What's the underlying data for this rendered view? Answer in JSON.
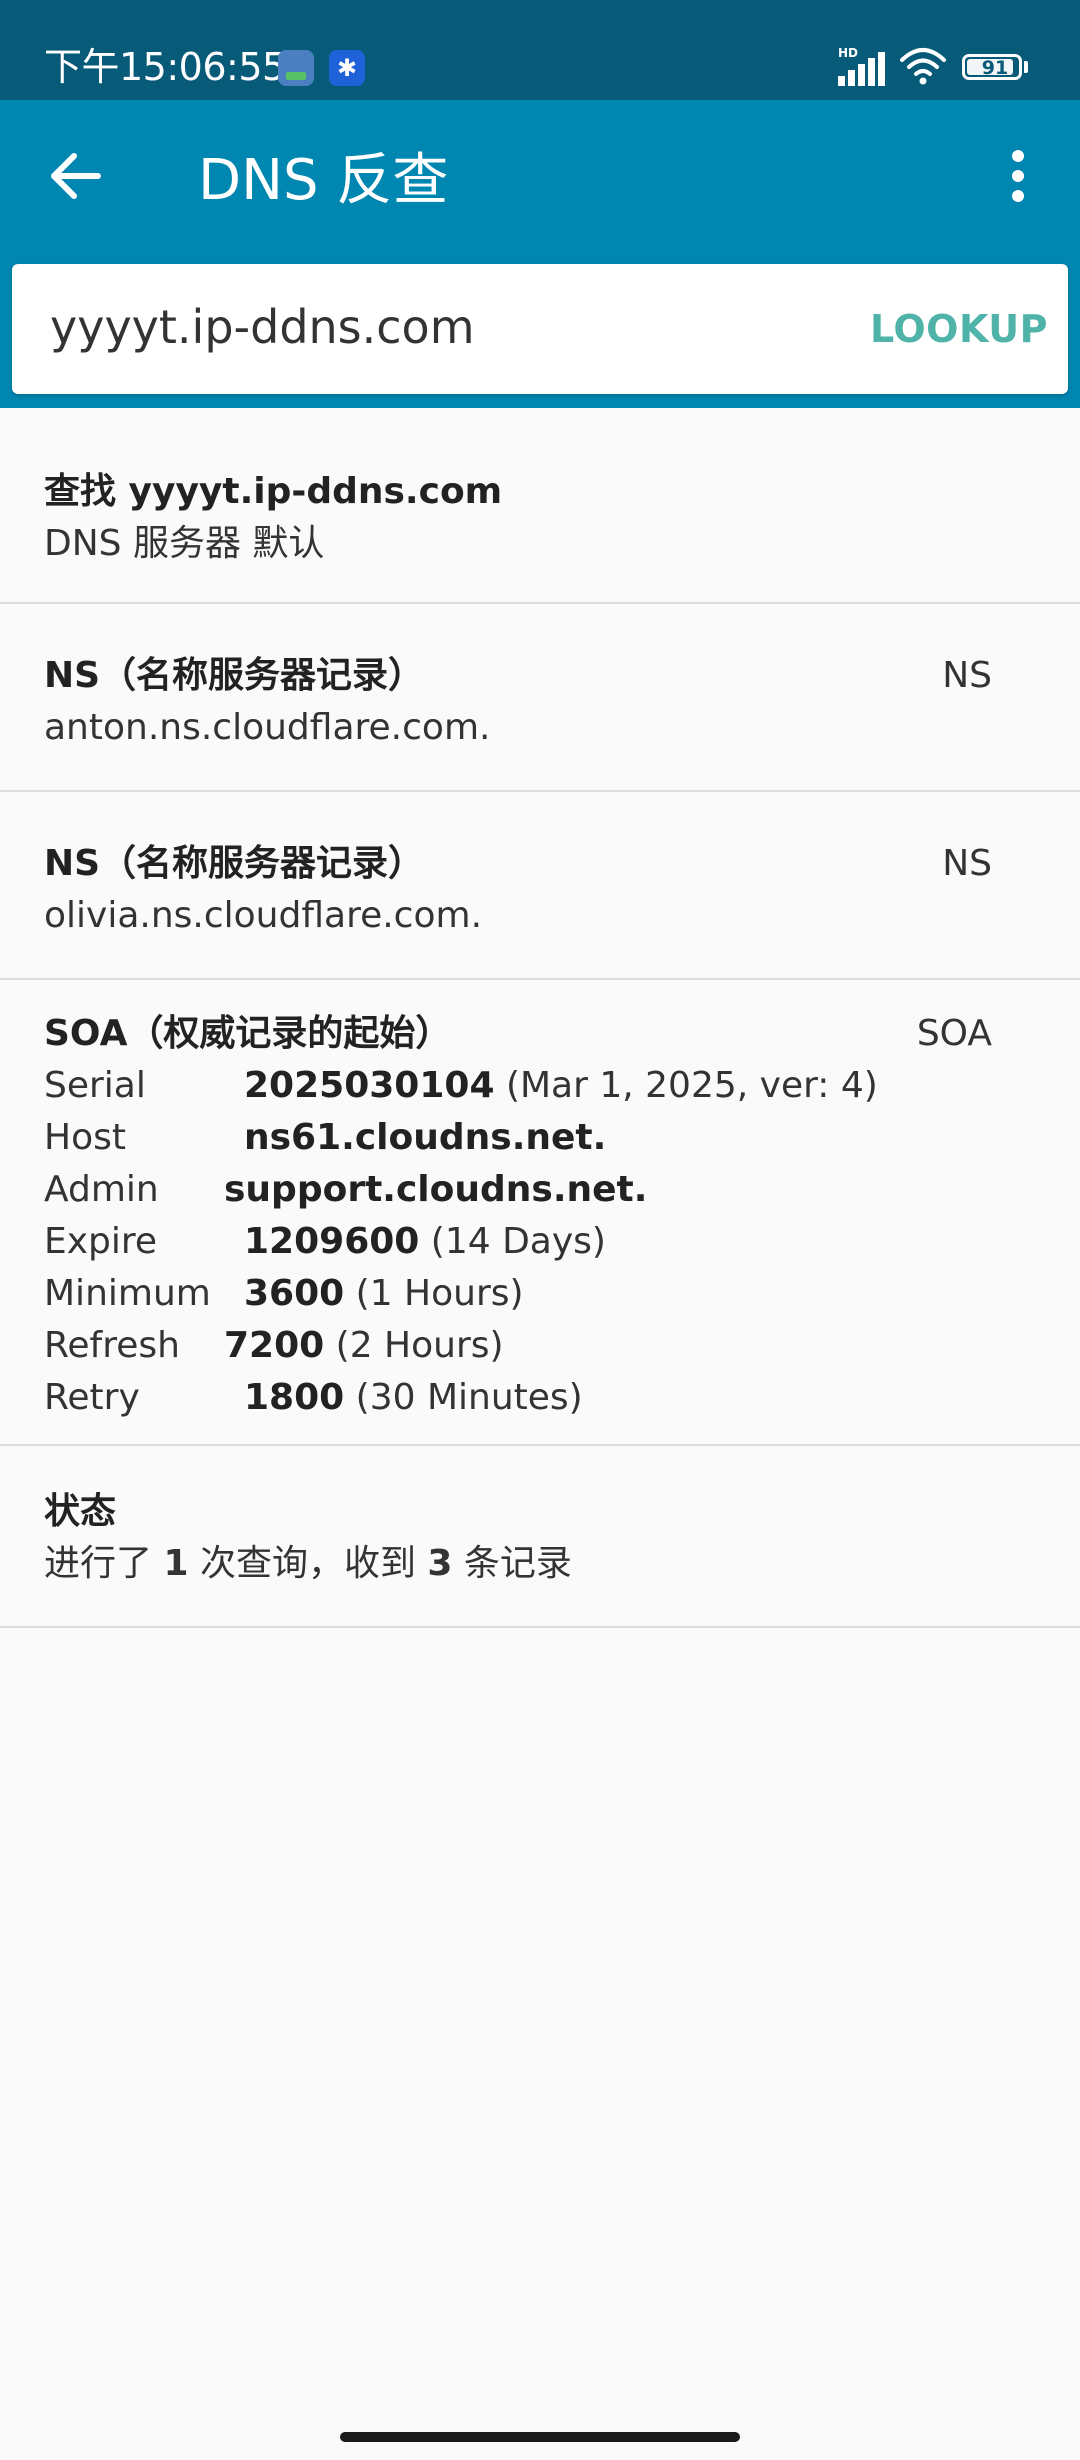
{
  "status_bar": {
    "time": "下午15:06:55",
    "network_badge": "HD",
    "battery": "91"
  },
  "app_bar": {
    "title": "DNS 反查",
    "back_icon": "arrow-back-icon",
    "menu_icon": "more-vert-icon"
  },
  "search": {
    "value": "yyyyt.ip-ddns.com",
    "lookup_label": "LOOKUP"
  },
  "query_info": {
    "title": "查找 yyyyt.ip-ddns.com",
    "subtitle": "DNS 服务器 默认"
  },
  "records": [
    {
      "title": "NS（名称服务器记录）",
      "value": "anton.ns.cloudflare.com.",
      "type": "NS"
    },
    {
      "title": "NS（名称服务器记录）",
      "value": "olivia.ns.cloudflare.com.",
      "type": "NS"
    }
  ],
  "soa": {
    "title": "SOA（权威记录的起始）",
    "type": "SOA",
    "fields": [
      {
        "key": "Serial",
        "value": "2025030104",
        "note": " (Mar 1, 2025, ver: 4)"
      },
      {
        "key": "Host",
        "value": "ns61.cloudns.net.",
        "note": ""
      },
      {
        "key": "Admin",
        "value": "support.cloudns.net.",
        "note": ""
      },
      {
        "key": "Expire",
        "value": "1209600",
        "note": " (14 Days)"
      },
      {
        "key": "Minimum",
        "value": "3600",
        "note": " (1 Hours)"
      },
      {
        "key": "Refresh",
        "value": "7200",
        "note": " (2 Hours)"
      },
      {
        "key": "Retry",
        "value": "1800",
        "note": " (30 Minutes)"
      }
    ]
  },
  "status": {
    "title": "状态",
    "prefix": "进行了 ",
    "queries": "1",
    "middle": " 次查询，收到 ",
    "records_count": "3",
    "suffix": " 条记录"
  }
}
